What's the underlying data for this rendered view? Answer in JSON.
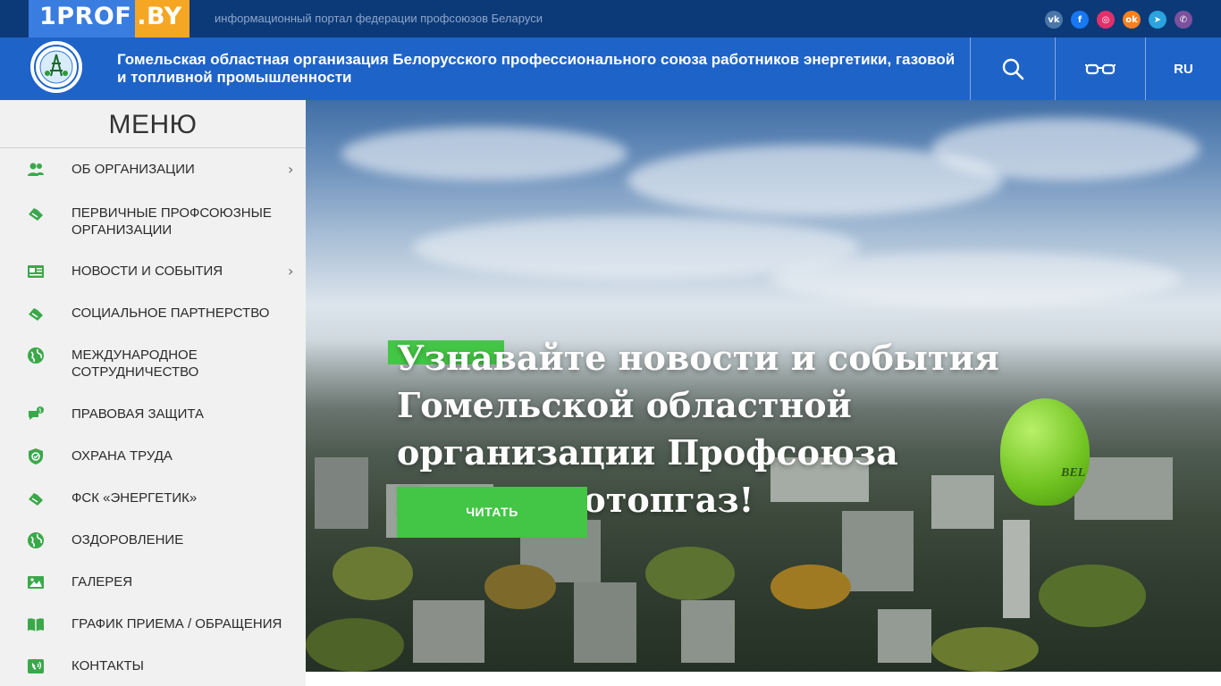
{
  "topbar": {
    "logo_part1": "1PROF",
    "logo_part2": ".BY",
    "tagline": "информационный портал федерации профсоюзов Беларуси",
    "socials": [
      {
        "name": "vk-icon",
        "glyph": "vk",
        "color": "#4a76a8"
      },
      {
        "name": "facebook-icon",
        "glyph": "f",
        "color": "#1877f2"
      },
      {
        "name": "instagram-icon",
        "glyph": "◎",
        "color": "#e1306c"
      },
      {
        "name": "odnoklassniki-icon",
        "glyph": "ok",
        "color": "#f58220"
      },
      {
        "name": "telegram-icon",
        "glyph": "➤",
        "color": "#2aa3df"
      },
      {
        "name": "viber-icon",
        "glyph": "✆",
        "color": "#7b519d"
      }
    ]
  },
  "header": {
    "org_title": "Гомельская областная организация Белорусского профессионального союза работников энергетики, газовой и топливной промышленности",
    "lang": "RU"
  },
  "menu": {
    "title": "МЕНЮ",
    "items": [
      {
        "label": "Об организации",
        "icon": "users-icon",
        "has_submenu": true
      },
      {
        "label": "Первичные профсоюзные организации",
        "icon": "handshake-icon",
        "has_submenu": false
      },
      {
        "label": "Новости и события",
        "icon": "newspaper-icon",
        "has_submenu": true
      },
      {
        "label": "Социальное партнерство",
        "icon": "handshake-icon",
        "has_submenu": false
      },
      {
        "label": "Международное сотрудничество",
        "icon": "globe-icon",
        "has_submenu": false
      },
      {
        "label": "Правовая защита",
        "icon": "chat-icon",
        "has_submenu": false
      },
      {
        "label": "Охрана труда",
        "icon": "shield-icon",
        "has_submenu": false
      },
      {
        "label": "ФСК «Энергетик»",
        "icon": "handshake-icon",
        "has_submenu": false
      },
      {
        "label": "Оздоровление",
        "icon": "globe-icon",
        "has_submenu": false
      },
      {
        "label": "Галерея",
        "icon": "image-icon",
        "has_submenu": false
      },
      {
        "label": "График приема / обращения",
        "icon": "book-icon",
        "has_submenu": false
      },
      {
        "label": "Контакты",
        "icon": "phone-icon",
        "has_submenu": false
      }
    ],
    "chevron": "›"
  },
  "hero": {
    "title": "Узнавайте новости и события Гомельской областной организации Профсоюза Белэнерготопгаз!",
    "button_label": "ЧИТАТЬ",
    "balloon_text": "BEL"
  },
  "colors": {
    "accent_green": "#43c545",
    "header_blue": "#1e63c8",
    "topbar_navy": "#0c3a78"
  }
}
